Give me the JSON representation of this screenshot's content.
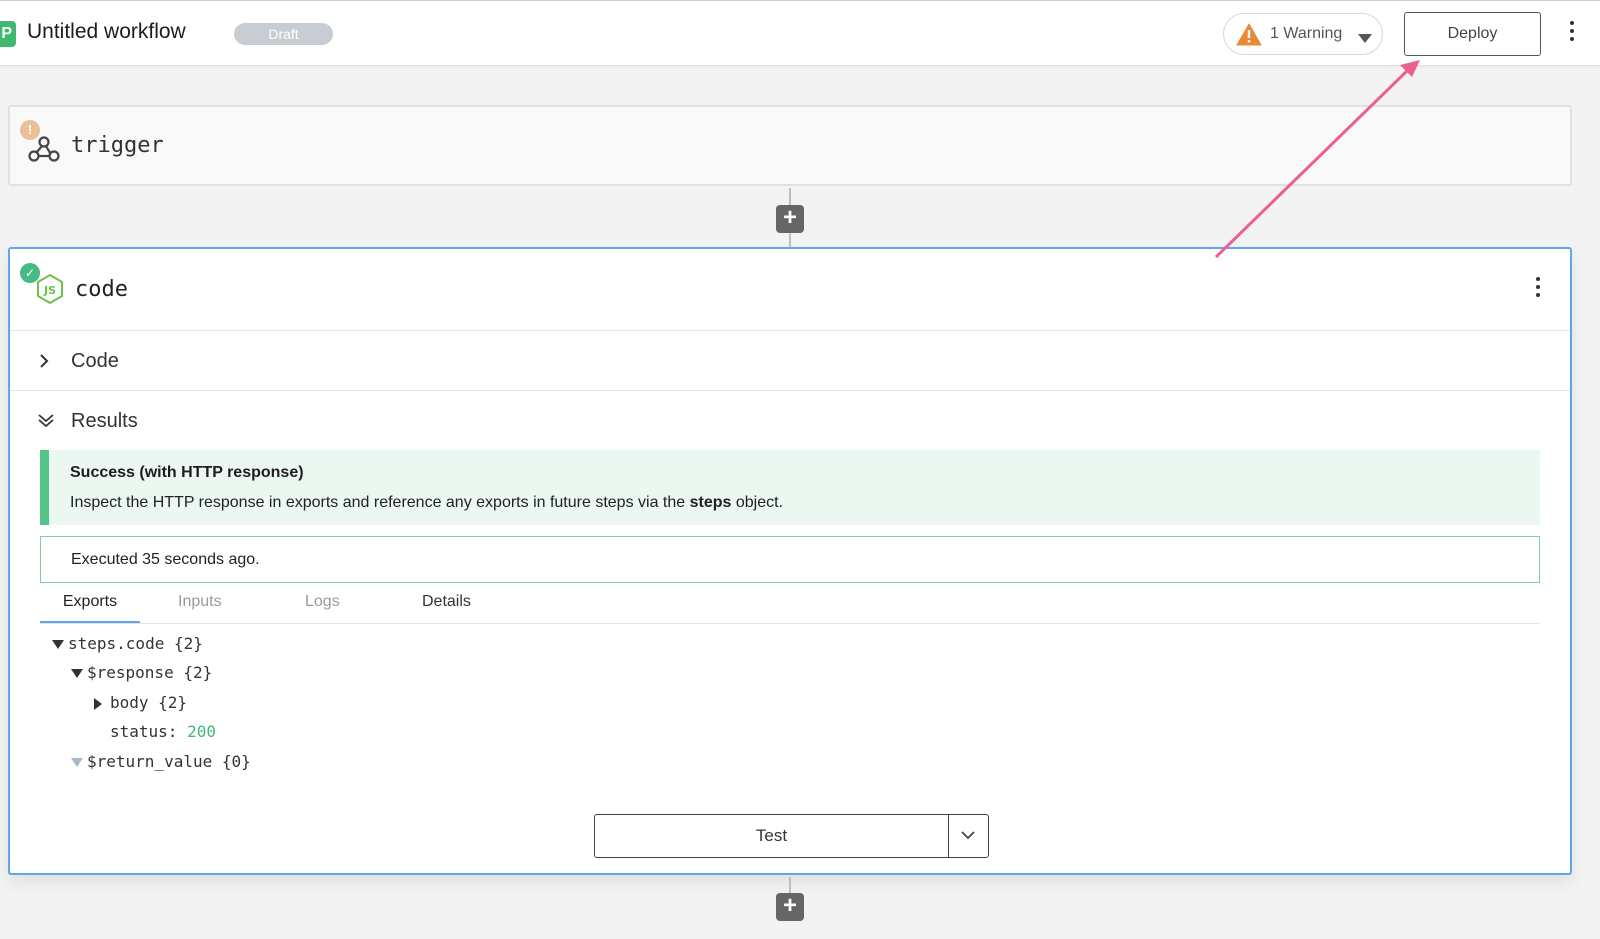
{
  "header": {
    "logo_letter": "P",
    "title": "Untitled workflow",
    "draft_badge": "Draft",
    "warning_label": "1 Warning",
    "deploy_label": "Deploy"
  },
  "trigger": {
    "badge": "!",
    "name": "trigger"
  },
  "code_step": {
    "name": "code",
    "sections": {
      "code_label": "Code",
      "results_label": "Results"
    },
    "success": {
      "title": "Success (with HTTP response)",
      "desc_before": "Inspect the HTTP response in exports and reference any exports in future steps via the ",
      "desc_bold": "steps",
      "desc_after": " object."
    },
    "executed": "Executed 35 seconds ago.",
    "tabs": [
      "Exports",
      "Inputs",
      "Logs",
      "Details"
    ],
    "tree": {
      "root": "steps.code {2}",
      "response": "$response {2}",
      "body": "body {2}",
      "status_key": "status:",
      "status_value": "200",
      "return_value": "$return_value {0}"
    },
    "test_label": "Test"
  },
  "colors": {
    "accent_blue": "#61a5ec",
    "success_green": "#55c487",
    "warning_orange": "#e8893a",
    "annotation_pink": "#ec5f94"
  }
}
